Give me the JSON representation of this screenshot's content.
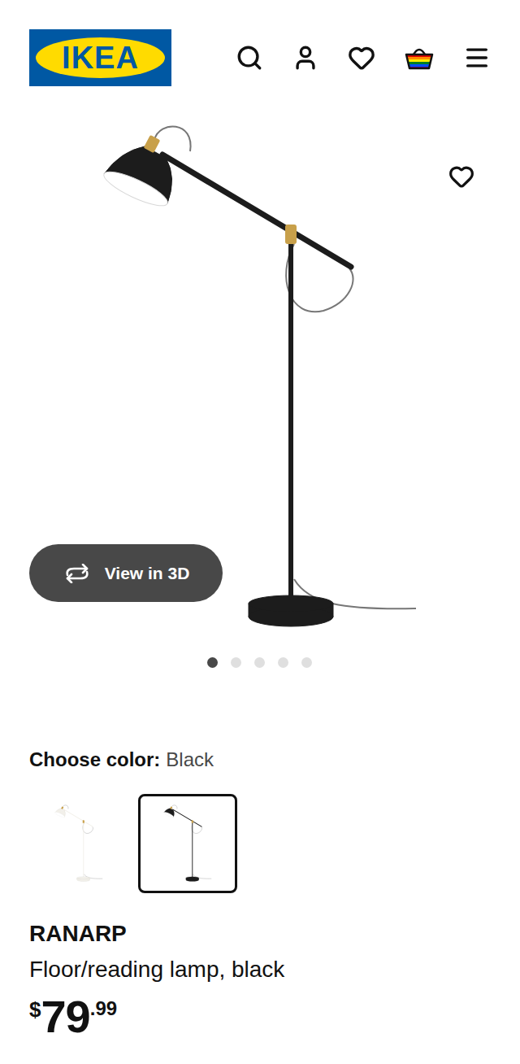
{
  "header": {
    "logo": "IKEA"
  },
  "gallery": {
    "view_3d": "View in 3D",
    "dots": [
      {
        "selected": true
      },
      {
        "selected": false
      },
      {
        "selected": false
      },
      {
        "selected": false
      },
      {
        "selected": false
      }
    ]
  },
  "color_picker": {
    "label": "Choose color:",
    "value": "Black",
    "swatches": [
      {
        "color": "#f2f0ea",
        "selected": false
      },
      {
        "color": "#1c1c1c",
        "selected": true
      }
    ]
  },
  "product": {
    "name": "RANARP",
    "description": "Floor/reading lamp, black",
    "price": {
      "currency": "$",
      "whole": "79",
      "cents": ".99"
    }
  }
}
